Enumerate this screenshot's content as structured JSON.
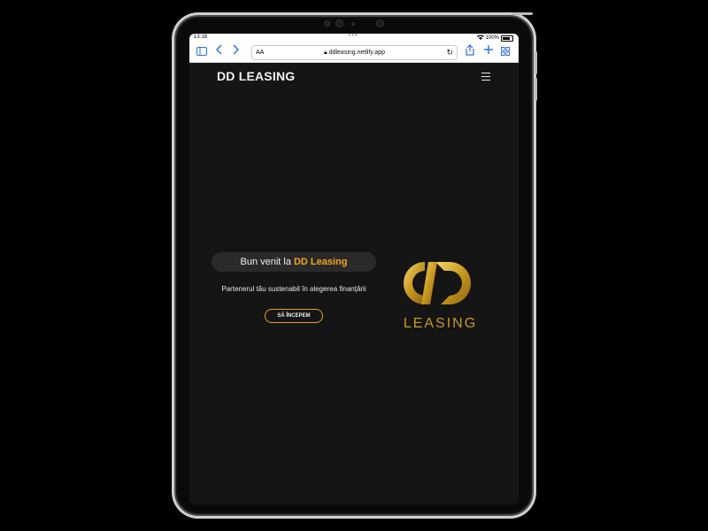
{
  "status_bar": {
    "time": "13:18",
    "battery": "100%"
  },
  "browser": {
    "url": "ddleasing.netlify.app",
    "aa_label": "AA"
  },
  "site": {
    "title": "DD LEASING"
  },
  "hero": {
    "welcome_prefix": "Bun venit la",
    "welcome_brand": "DD Leasing",
    "tagline": "Partenerul tău sustenabil în alegerea finanțării",
    "cta_label": "SĂ ÎNCEPEM",
    "accent_color": "#f2a31b"
  },
  "logo": {
    "text": "LEASING",
    "color": "#c69a27"
  }
}
